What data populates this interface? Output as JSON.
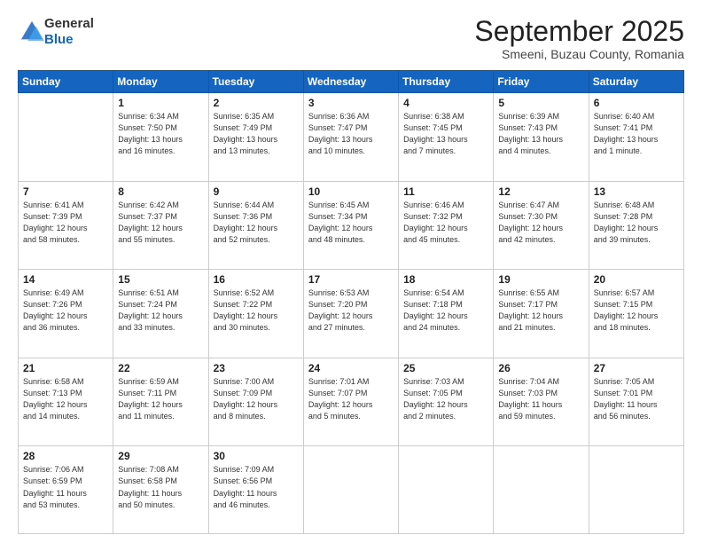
{
  "logo": {
    "general": "General",
    "blue": "Blue"
  },
  "header": {
    "month": "September 2025",
    "location": "Smeeni, Buzau County, Romania"
  },
  "days_of_week": [
    "Sunday",
    "Monday",
    "Tuesday",
    "Wednesday",
    "Thursday",
    "Friday",
    "Saturday"
  ],
  "weeks": [
    [
      {
        "day": "",
        "content": ""
      },
      {
        "day": "1",
        "content": "Sunrise: 6:34 AM\nSunset: 7:50 PM\nDaylight: 13 hours\nand 16 minutes."
      },
      {
        "day": "2",
        "content": "Sunrise: 6:35 AM\nSunset: 7:49 PM\nDaylight: 13 hours\nand 13 minutes."
      },
      {
        "day": "3",
        "content": "Sunrise: 6:36 AM\nSunset: 7:47 PM\nDaylight: 13 hours\nand 10 minutes."
      },
      {
        "day": "4",
        "content": "Sunrise: 6:38 AM\nSunset: 7:45 PM\nDaylight: 13 hours\nand 7 minutes."
      },
      {
        "day": "5",
        "content": "Sunrise: 6:39 AM\nSunset: 7:43 PM\nDaylight: 13 hours\nand 4 minutes."
      },
      {
        "day": "6",
        "content": "Sunrise: 6:40 AM\nSunset: 7:41 PM\nDaylight: 13 hours\nand 1 minute."
      }
    ],
    [
      {
        "day": "7",
        "content": "Sunrise: 6:41 AM\nSunset: 7:39 PM\nDaylight: 12 hours\nand 58 minutes."
      },
      {
        "day": "8",
        "content": "Sunrise: 6:42 AM\nSunset: 7:37 PM\nDaylight: 12 hours\nand 55 minutes."
      },
      {
        "day": "9",
        "content": "Sunrise: 6:44 AM\nSunset: 7:36 PM\nDaylight: 12 hours\nand 52 minutes."
      },
      {
        "day": "10",
        "content": "Sunrise: 6:45 AM\nSunset: 7:34 PM\nDaylight: 12 hours\nand 48 minutes."
      },
      {
        "day": "11",
        "content": "Sunrise: 6:46 AM\nSunset: 7:32 PM\nDaylight: 12 hours\nand 45 minutes."
      },
      {
        "day": "12",
        "content": "Sunrise: 6:47 AM\nSunset: 7:30 PM\nDaylight: 12 hours\nand 42 minutes."
      },
      {
        "day": "13",
        "content": "Sunrise: 6:48 AM\nSunset: 7:28 PM\nDaylight: 12 hours\nand 39 minutes."
      }
    ],
    [
      {
        "day": "14",
        "content": "Sunrise: 6:49 AM\nSunset: 7:26 PM\nDaylight: 12 hours\nand 36 minutes."
      },
      {
        "day": "15",
        "content": "Sunrise: 6:51 AM\nSunset: 7:24 PM\nDaylight: 12 hours\nand 33 minutes."
      },
      {
        "day": "16",
        "content": "Sunrise: 6:52 AM\nSunset: 7:22 PM\nDaylight: 12 hours\nand 30 minutes."
      },
      {
        "day": "17",
        "content": "Sunrise: 6:53 AM\nSunset: 7:20 PM\nDaylight: 12 hours\nand 27 minutes."
      },
      {
        "day": "18",
        "content": "Sunrise: 6:54 AM\nSunset: 7:18 PM\nDaylight: 12 hours\nand 24 minutes."
      },
      {
        "day": "19",
        "content": "Sunrise: 6:55 AM\nSunset: 7:17 PM\nDaylight: 12 hours\nand 21 minutes."
      },
      {
        "day": "20",
        "content": "Sunrise: 6:57 AM\nSunset: 7:15 PM\nDaylight: 12 hours\nand 18 minutes."
      }
    ],
    [
      {
        "day": "21",
        "content": "Sunrise: 6:58 AM\nSunset: 7:13 PM\nDaylight: 12 hours\nand 14 minutes."
      },
      {
        "day": "22",
        "content": "Sunrise: 6:59 AM\nSunset: 7:11 PM\nDaylight: 12 hours\nand 11 minutes."
      },
      {
        "day": "23",
        "content": "Sunrise: 7:00 AM\nSunset: 7:09 PM\nDaylight: 12 hours\nand 8 minutes."
      },
      {
        "day": "24",
        "content": "Sunrise: 7:01 AM\nSunset: 7:07 PM\nDaylight: 12 hours\nand 5 minutes."
      },
      {
        "day": "25",
        "content": "Sunrise: 7:03 AM\nSunset: 7:05 PM\nDaylight: 12 hours\nand 2 minutes."
      },
      {
        "day": "26",
        "content": "Sunrise: 7:04 AM\nSunset: 7:03 PM\nDaylight: 11 hours\nand 59 minutes."
      },
      {
        "day": "27",
        "content": "Sunrise: 7:05 AM\nSunset: 7:01 PM\nDaylight: 11 hours\nand 56 minutes."
      }
    ],
    [
      {
        "day": "28",
        "content": "Sunrise: 7:06 AM\nSunset: 6:59 PM\nDaylight: 11 hours\nand 53 minutes."
      },
      {
        "day": "29",
        "content": "Sunrise: 7:08 AM\nSunset: 6:58 PM\nDaylight: 11 hours\nand 50 minutes."
      },
      {
        "day": "30",
        "content": "Sunrise: 7:09 AM\nSunset: 6:56 PM\nDaylight: 11 hours\nand 46 minutes."
      },
      {
        "day": "",
        "content": ""
      },
      {
        "day": "",
        "content": ""
      },
      {
        "day": "",
        "content": ""
      },
      {
        "day": "",
        "content": ""
      }
    ]
  ]
}
